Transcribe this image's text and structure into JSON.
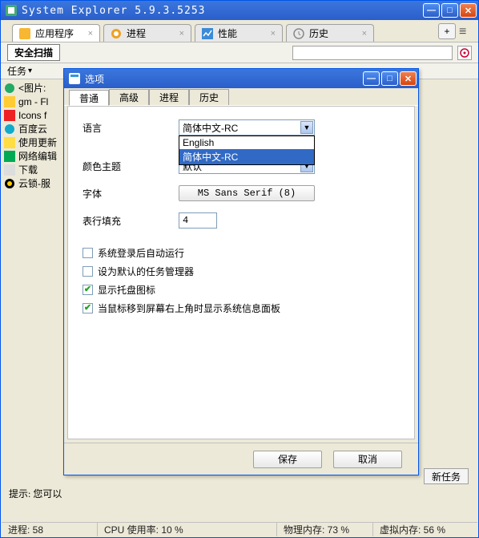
{
  "window": {
    "title": "System Explorer 5.9.3.5253"
  },
  "tabs": [
    {
      "label": "应用程序"
    },
    {
      "label": "进程"
    },
    {
      "label": "性能"
    },
    {
      "label": "历史"
    }
  ],
  "toolbar": {
    "scan": "安全扫描",
    "search_placeholder": ""
  },
  "tasks_header": "任务",
  "task_items": [
    "<图片:",
    "gm - Fl",
    "Icons f",
    "百度云",
    "使用更新",
    "网络编辑",
    "下载",
    "云锁-服"
  ],
  "dialog": {
    "title": "选项",
    "tabs": [
      "普通",
      "高级",
      "进程",
      "历史"
    ],
    "labels": {
      "language": "语言",
      "theme": "颜色主题",
      "font": "字体",
      "padding": "表行填充"
    },
    "language_value": "简体中文-RC",
    "language_options": [
      "English",
      "简体中文-RC"
    ],
    "theme_value": "默认",
    "font_value": "MS Sans Serif (8)",
    "padding_value": "4",
    "checks": {
      "c1": {
        "label": "系统登录后自动运行",
        "checked": false
      },
      "c2": {
        "label": "设为默认的任务管理器",
        "checked": false
      },
      "c3": {
        "label": "显示托盘图标",
        "checked": true
      },
      "c4": {
        "label": "当鼠标移到屏幕右上角时显示系统信息面板",
        "checked": true
      }
    },
    "buttons": {
      "save": "保存",
      "cancel": "取消"
    }
  },
  "newtask": "新任务",
  "hint": "提示: 您可以",
  "status": {
    "processes": "进程: 58",
    "cpu": "CPU 使用率: 10 %",
    "mem": "物理内存: 73 %",
    "vmem": "虚拟内存: 56 %"
  }
}
